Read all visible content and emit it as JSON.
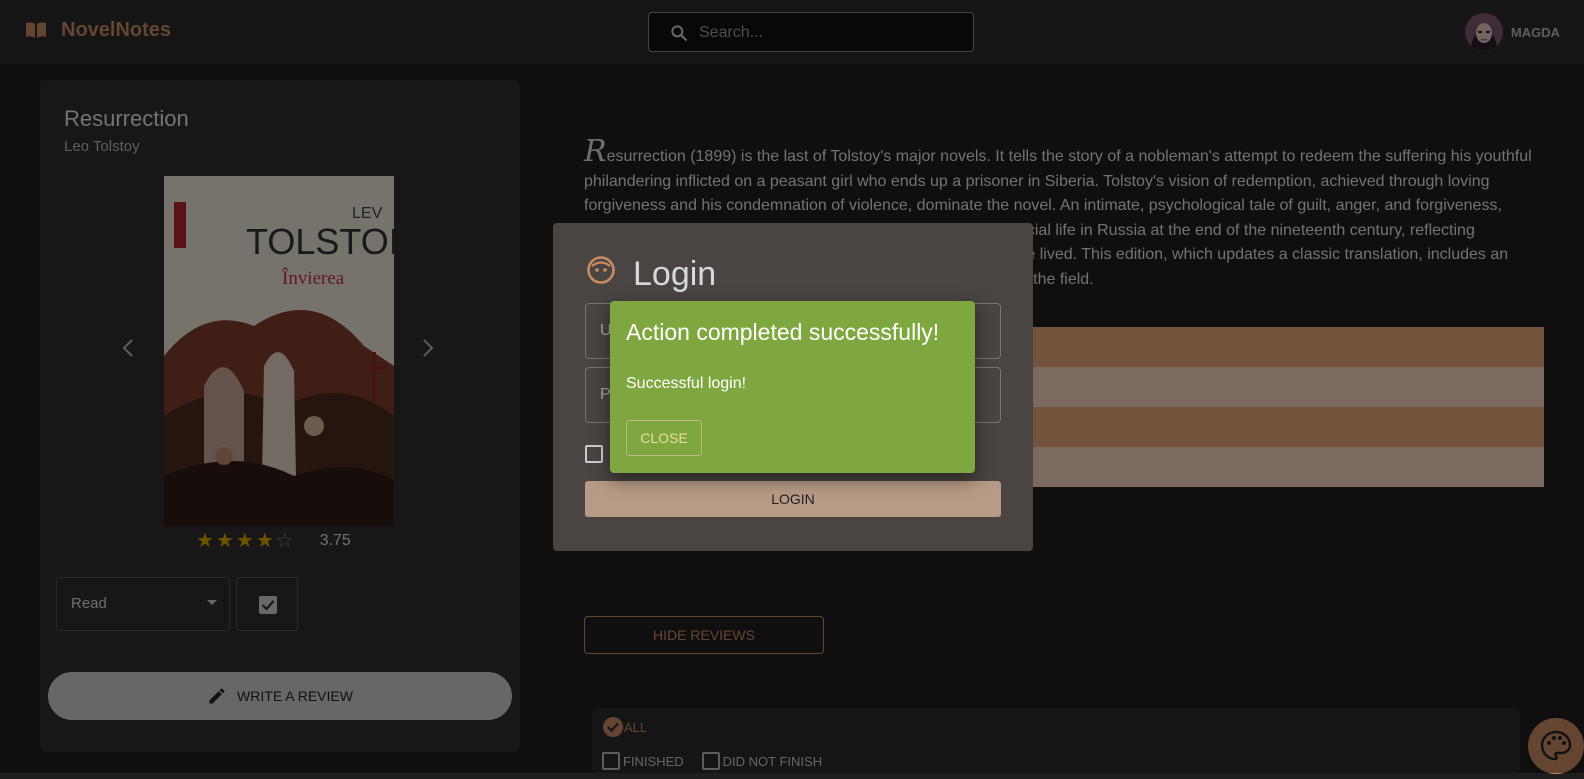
{
  "header": {
    "brand": "NovelNotes",
    "search_placeholder": "Search...",
    "username": "MAGDA"
  },
  "book": {
    "title": "Resurrection",
    "author": "Leo Tolstoy",
    "cover": {
      "author_line1": "LEV",
      "author_line2": "TOLSTOI",
      "title": "Învierea"
    },
    "rating": "3.75",
    "rating_value": 3.75,
    "rating_max": 5,
    "status": "Read",
    "write_review_label": "WRITE A REVIEW"
  },
  "description": {
    "drop_cap": "R",
    "text": "esurrection (1899) is the last of Tolstoy's major novels. It tells the story of a nobleman's attempt to redeem the suffering his youthful philandering inflicted on a peasant girl who ends up a prisoner in Siberia. Tolstoy's vision of redemption, achieved through loving forgiveness and his condemnation of violence, dominate the novel. An intimate, psychological tale of guilt, anger, and forgiveness, Resurrection is at the same time a panoramic description of social life in Russia at the end of the nineteenth century, reflecting Tolstoy's outrage at the social injustices of the world in which he lived. This edition, which updates a classic translation, includes an introduction and notes based on the most recent scholarship in the field."
  },
  "reviews": {
    "hide_label": "HIDE REVIEWS",
    "filters": {
      "all": "ALL",
      "finished": "FINISHED",
      "did_not_finish": "DID NOT FINISH"
    }
  },
  "login_dialog": {
    "title": "Login",
    "username_label": "U",
    "password_label": "P",
    "login_button": "LOGIN"
  },
  "success_dialog": {
    "title": "Action completed successfully!",
    "message": "Successful login!",
    "close_button": "CLOSE"
  },
  "colors": {
    "accent": "#c98b62",
    "success": "#7ea73f",
    "star": "#d9a400"
  }
}
